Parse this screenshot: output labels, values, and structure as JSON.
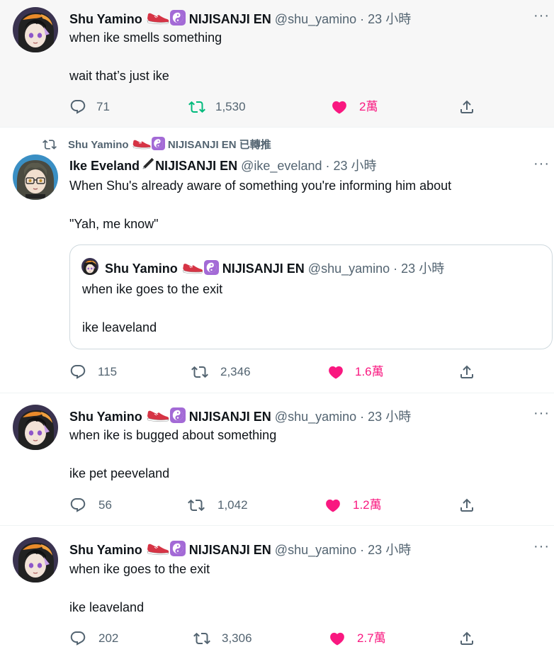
{
  "tweets": [
    {
      "name": "Shu Yamino",
      "org": "NIJISANJI EN",
      "handle": "@shu_yamino",
      "time": "23 小時",
      "lines": [
        "when ike smells something",
        "wait that’s just ike"
      ],
      "replies": "71",
      "retweets": "1,530",
      "likes": "2萬",
      "liked": true
    },
    {
      "retweeted_by": "Shu Yamino",
      "retweeted_org": "NIJISANJI EN",
      "retweeted_suffix": "已轉推",
      "name": "Ike Eveland",
      "org": "NIJISANJI EN",
      "handle": "@ike_eveland",
      "time": "23 小時",
      "lines": [
        "When Shu's already aware of something you're informing him about",
        "\"Yah, me know\""
      ],
      "quote": {
        "name": "Shu Yamino",
        "org": "NIJISANJI EN",
        "handle": "@shu_yamino",
        "time": "23 小時",
        "lines": [
          "when ike goes to the exit",
          "ike leaveland"
        ]
      },
      "replies": "115",
      "retweets": "2,346",
      "likes": "1.6萬",
      "liked": true
    },
    {
      "name": "Shu Yamino",
      "org": "NIJISANJI EN",
      "handle": "@shu_yamino",
      "time": "23 小時",
      "lines": [
        "when ike is bugged about something",
        "ike pet peeveland"
      ],
      "replies": "56",
      "retweets": "1,042",
      "likes": "1.2萬",
      "liked": true
    },
    {
      "name": "Shu Yamino",
      "org": "NIJISANJI EN",
      "handle": "@shu_yamino",
      "time": "23 小時",
      "lines": [
        "when ike goes to the exit",
        "ike leaveland"
      ],
      "replies": "202",
      "retweets": "3,306",
      "likes": "2.7萬",
      "liked": true
    }
  ],
  "ui": {
    "separator": "·",
    "more": "···"
  },
  "colors": {
    "like": "#f91880",
    "muted": "#536471",
    "text": "#0f1419",
    "highlight_bg": "#f7f7f7",
    "yinyang_badge": "#a36ad6"
  },
  "icons": [
    "sneaker-icon",
    "yinyang-icon",
    "pen-icon",
    "reply-icon",
    "retweet-icon",
    "heart-icon",
    "share-icon",
    "more-icon"
  ]
}
